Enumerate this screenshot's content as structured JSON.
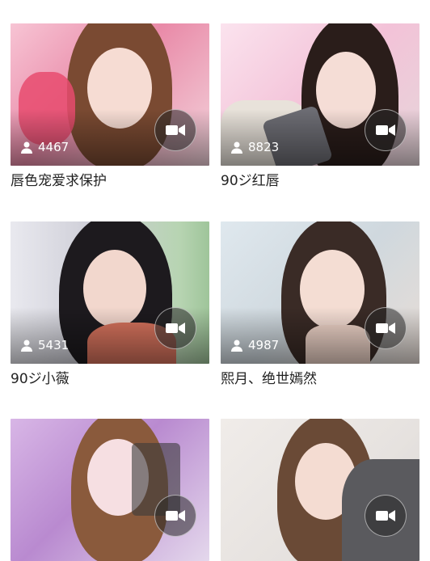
{
  "cards": [
    {
      "viewers": "4467",
      "title": "唇色宠爱求保护",
      "bg": "#f2b7c9",
      "accent": "#e84b6e",
      "hair": "#7a4a32"
    },
    {
      "viewers": "8823",
      "title": "90ジ红唇",
      "bg": "#f7d6e6",
      "accent": "#c9a36e",
      "hair": "#2a1d1a"
    },
    {
      "viewers": "5431",
      "title": "90ジ小薇",
      "bg": "#d9d9e4",
      "accent": "#a7c9a4",
      "hair": "#1d1a1e"
    },
    {
      "viewers": "4987",
      "title": "熙月、绝世嫣然",
      "bg": "#d7e0e6",
      "accent": "#c8b6a8",
      "hair": "#3a2b26"
    },
    {
      "viewers": "",
      "title": "",
      "bg": "#caa6d8",
      "accent": "#b07cc8",
      "hair": "#8a5a3c"
    },
    {
      "viewers": "",
      "title": "",
      "bg": "#ebe8e6",
      "accent": "#8a8a8a",
      "hair": "#6a4a36"
    }
  ],
  "icons": {
    "viewer": "person-icon",
    "camera": "video-camera-icon"
  }
}
